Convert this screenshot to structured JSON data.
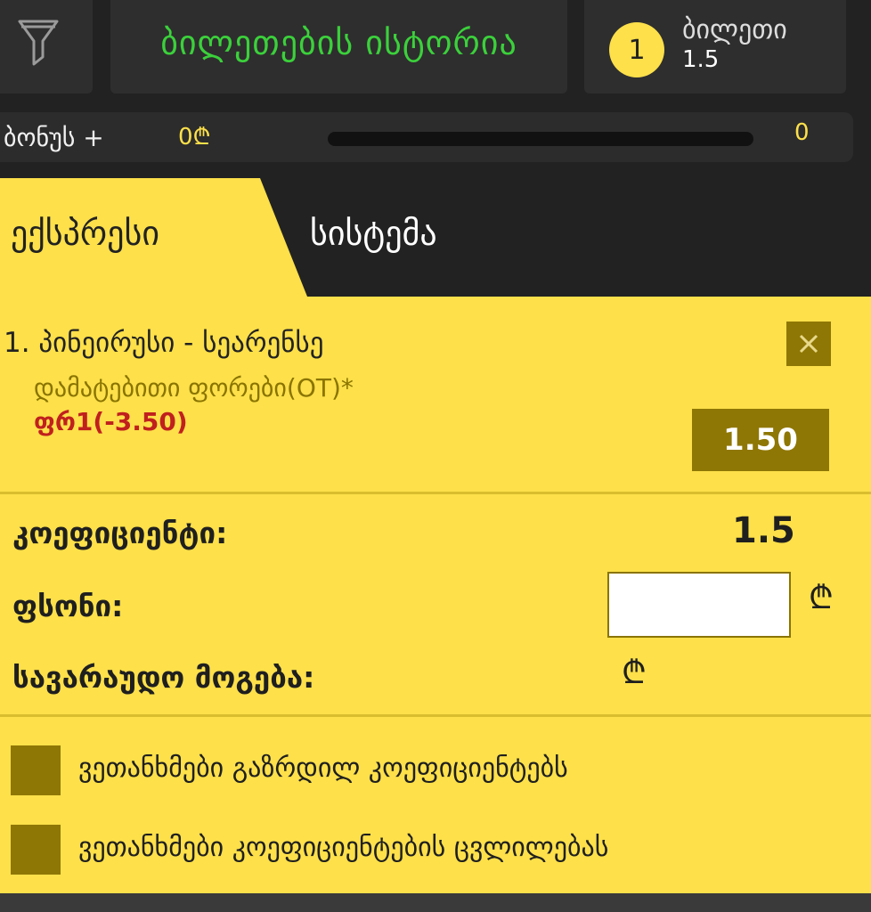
{
  "header": {
    "history_title": "ბილეთების ისტორია",
    "ticket_count": "1",
    "ticket_label": "ბილეთი",
    "ticket_odds": "1.5"
  },
  "bonus": {
    "label": "ბონუს +",
    "amount": "0₾",
    "count": "0",
    "progress": 0
  },
  "tabs": [
    {
      "label": "ექსპრესი",
      "active": true
    },
    {
      "label": "სისტემა",
      "active": false
    }
  ],
  "bet": {
    "event_name": "1. პინეირუსი - სეარენსე",
    "market": "დამატებითი ფორები(OT)*",
    "selection": "ფრ1(-3.50)",
    "odds": "1.50"
  },
  "summary": {
    "coef_label": "კოეფიციენტი:",
    "coef_value": "1.5",
    "stake_label": "ფსონი:",
    "stake_value": "",
    "win_label": "სავარაუდო მოგება:",
    "currency": "₾"
  },
  "options": [
    {
      "label": "ვეთანხმები გაზრდილ კოეფიციენტებს",
      "checked": false
    },
    {
      "label": "ვეთანხმები კოეფიციენტების ცვლილებას",
      "checked": false
    }
  ],
  "colors": {
    "accent": "#fde04a",
    "dark": "#222222",
    "olive": "#8f7705",
    "green": "#3bd13b",
    "red": "#c0201e"
  }
}
